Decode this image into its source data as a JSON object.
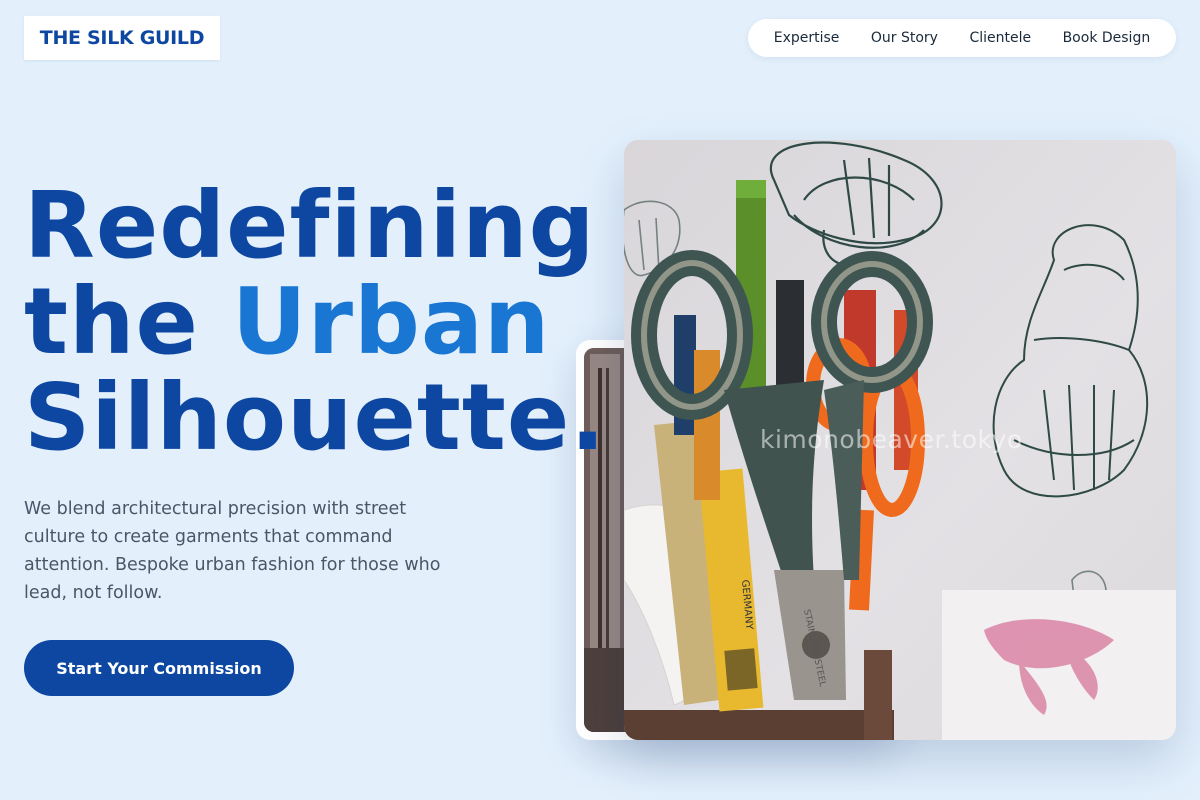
{
  "brand": {
    "name": "THE SILK GUILD"
  },
  "nav": {
    "items": [
      {
        "label": "Expertise"
      },
      {
        "label": "Our Story"
      },
      {
        "label": "Clientele"
      },
      {
        "label": "Book Design"
      }
    ]
  },
  "hero": {
    "line1": "Redefining",
    "line2_prefix": "the ",
    "line2_accent": "Urban",
    "line3": "Silhouette",
    "period": ".",
    "lead": "We blend architectural precision with street culture to create garments that command attention. Bespoke urban fashion for those who lead, not follow.",
    "cta": "Start Your Commission"
  },
  "gallery": {
    "watermark": "kimonobeaver.tokyo",
    "scissors_blade_text": "STAINLESS STEEL",
    "pencil_text": "GERMANY"
  },
  "colors": {
    "background": "#e3f0fc",
    "primary": "#0d47a1",
    "accent": "#1976d2",
    "body_text": "#4a5666"
  }
}
